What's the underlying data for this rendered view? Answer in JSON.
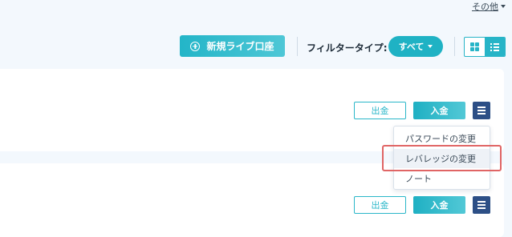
{
  "header": {
    "more_label": "その他",
    "new_account_label": "新規ライブ口座",
    "filter_label": "フィルタータイプ:",
    "filter_value": "すべて",
    "view_modes": [
      "grid",
      "list"
    ],
    "active_view": "list"
  },
  "accounts": [
    {
      "withdraw_label": "出金",
      "deposit_label": "入金"
    },
    {
      "withdraw_label": "出金",
      "deposit_label": "入金"
    }
  ],
  "dropdown": {
    "items": [
      {
        "label": "パスワードの変更"
      },
      {
        "label": "レバレッジの変更"
      },
      {
        "label": "ノート"
      }
    ],
    "hovered_index": 1
  },
  "colors": {
    "accent": "#1fb2c4",
    "menu_button": "#2d4f86",
    "highlight": "#e06565",
    "page_background": "#f3f8fd"
  },
  "icons": {
    "plus": "plus-circle-icon",
    "grid": "grid-view-icon",
    "list": "list-view-icon",
    "menu": "hamburger-menu-icon"
  }
}
